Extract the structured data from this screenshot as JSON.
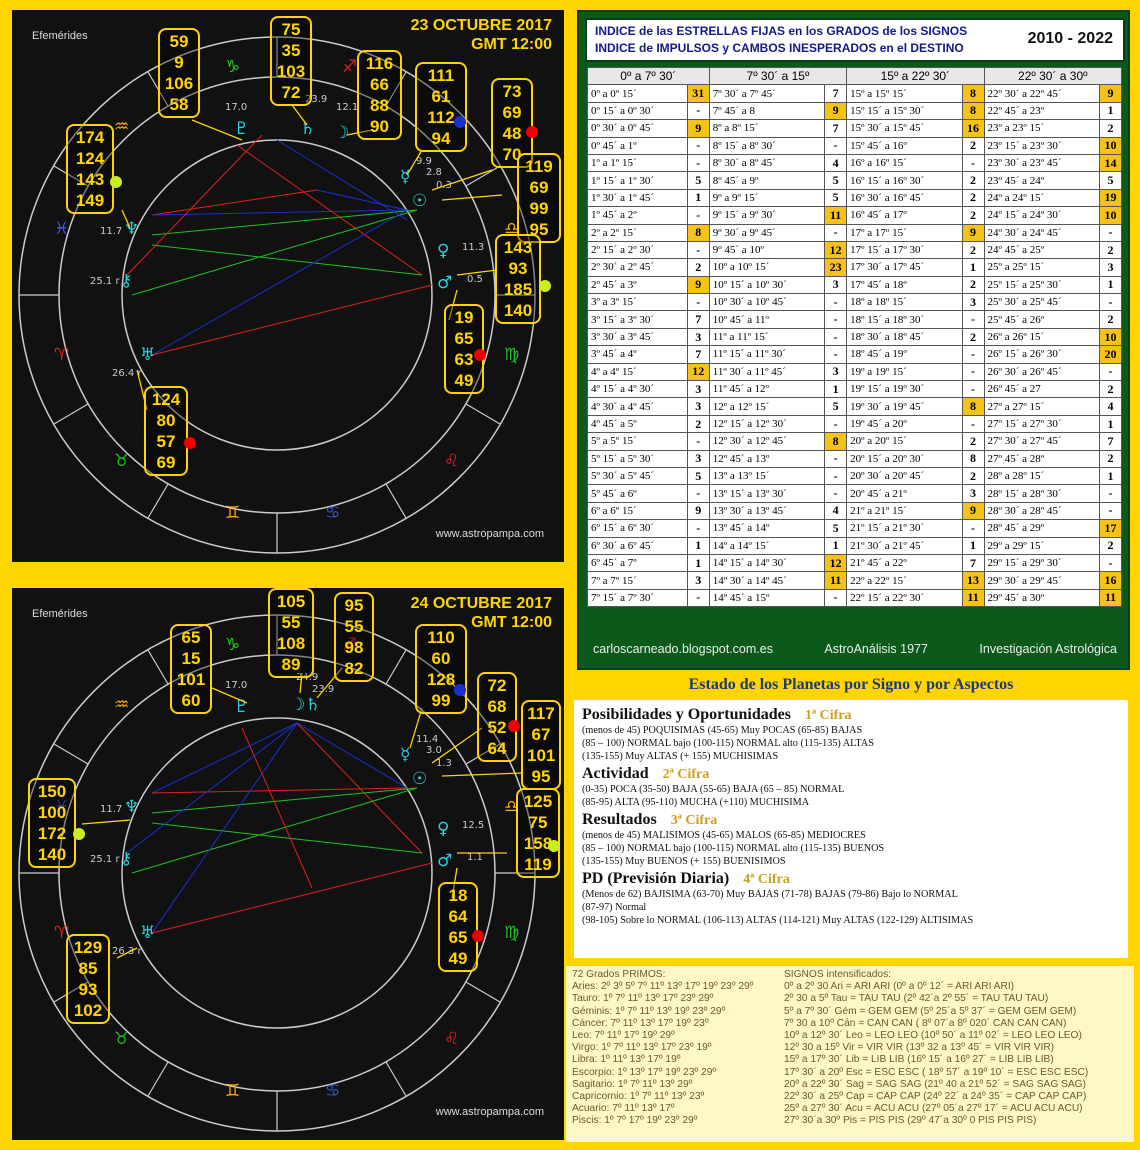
{
  "chart1": {
    "title_date": "23 OCTUBRE 2017",
    "title_time": "GMT 12:00",
    "efemerides": "Efemérides",
    "site": "www.astropampa.com",
    "degrees": [
      "17.0",
      "23.9",
      "12.1",
      "9.9",
      "2.8",
      "0.3",
      "11.3",
      "0.5",
      "11.7",
      "25.1 r",
      "26.4 r"
    ],
    "boxes": [
      {
        "id": "b1",
        "values": [
          "59",
          "9",
          "106",
          "58"
        ]
      },
      {
        "id": "b2",
        "values": [
          "75",
          "35",
          "103",
          "72"
        ]
      },
      {
        "id": "b3",
        "values": [
          "116",
          "66",
          "88",
          "90"
        ]
      },
      {
        "id": "b4",
        "values": [
          "111",
          "61",
          "112",
          "94"
        ]
      },
      {
        "id": "b5",
        "values": [
          "73",
          "69",
          "48",
          "70"
        ]
      },
      {
        "id": "b6",
        "values": [
          "119",
          "69",
          "99",
          "95"
        ]
      },
      {
        "id": "b7",
        "values": [
          "174",
          "124",
          "143",
          "149"
        ]
      },
      {
        "id": "b8",
        "values": [
          "143",
          "93",
          "185",
          "140"
        ]
      },
      {
        "id": "b9",
        "values": [
          "19",
          "65",
          "63",
          "49"
        ]
      },
      {
        "id": "b10",
        "values": [
          "124",
          "80",
          "57",
          "69"
        ]
      }
    ]
  },
  "chart2": {
    "title_date": "24 OCTUBRE 2017",
    "title_time": "GMT 12:00",
    "efemerides": "Efemérides",
    "site": "www.astropampa.com",
    "degrees": [
      "17.0",
      "24.9",
      "23.9",
      "11.4",
      "3.0",
      "1.3",
      "12.5",
      "1.1",
      "11.7",
      "25.1 r",
      "26.3 r"
    ],
    "boxes": [
      {
        "id": "c1",
        "values": [
          "65",
          "15",
          "101",
          "60"
        ]
      },
      {
        "id": "c2",
        "values": [
          "105",
          "55",
          "108",
          "89"
        ]
      },
      {
        "id": "c3",
        "values": [
          "95",
          "55",
          "98",
          "82"
        ]
      },
      {
        "id": "c4",
        "values": [
          "110",
          "60",
          "128",
          "99"
        ]
      },
      {
        "id": "c5",
        "values": [
          "72",
          "68",
          "52",
          "64"
        ]
      },
      {
        "id": "c6",
        "values": [
          "117",
          "67",
          "101",
          "95"
        ]
      },
      {
        "id": "c7",
        "values": [
          "150",
          "100",
          "172",
          "140"
        ]
      },
      {
        "id": "c8",
        "values": [
          "125",
          "75",
          "158",
          "119"
        ]
      },
      {
        "id": "c9",
        "values": [
          "18",
          "64",
          "65",
          "49"
        ]
      },
      {
        "id": "c10",
        "values": [
          "129",
          "85",
          "93",
          "102"
        ]
      }
    ]
  },
  "table": {
    "header_line1": "INDICE de las ESTRELLAS FIJAS en los GRADOS de los SIGNOS",
    "header_line2": "INDICE de IMPULSOS y CAMBOS INESPERADOS en el DESTINO",
    "years": "2010 - 2022",
    "columns": [
      "0º a 7º 30´",
      "7º 30´ a 15º",
      "15º a 22º 30´",
      "22º 30´ a 30º"
    ],
    "highlight_color": "#f5c21a",
    "rows": [
      [
        "0º a 0º 15´",
        "31",
        true,
        "7º 30´ a 7º 45´",
        "7",
        false,
        "15º a 15º 15´",
        "8",
        true,
        "22º 30´ a 22º 45´",
        "9",
        true
      ],
      [
        "0º 15´ a 0º 30´",
        "-",
        false,
        "7º 45´ a 8",
        "9",
        true,
        "15º 15´ a 15º 30´",
        "8",
        true,
        "22º 45´ a 23º",
        "1",
        false
      ],
      [
        "0º 30´ a 0º 45´",
        "9",
        true,
        "8º a 8º 15´",
        "7",
        false,
        "15º 30´ a 15º 45´",
        "16",
        true,
        "23º a 23º 15´",
        "2",
        false
      ],
      [
        "0º 45´ a 1º",
        "-",
        false,
        "8º 15´ a 8º 30´",
        "-",
        false,
        "15º 45´ a 16º",
        "2",
        false,
        "23º 15´ a 23º 30´",
        "10",
        true
      ],
      [
        "1º a 1º 15´",
        "-",
        false,
        "8º 30´ a 8º 45´",
        "4",
        false,
        "16º a 16º 15´",
        "-",
        false,
        "23º 30´ a 23º 45´",
        "14",
        true
      ],
      [
        "1º 15´ a 1º 30´",
        "5",
        false,
        "8º 45´ a 9º",
        "5",
        false,
        "16º 15´ a 16º 30´",
        "2",
        false,
        "23º 45´ a 24º",
        "5",
        false
      ],
      [
        "1º 30´ a 1º 45´",
        "1",
        false,
        "9º a 9º 15´",
        "5",
        false,
        "16º 30´ a 16º 45´",
        "2",
        false,
        "24º a 24º 15´",
        "19",
        true
      ],
      [
        "1º 45´ a 2º",
        "-",
        false,
        "9º 15´ a 9º 30´",
        "11",
        true,
        "16º 45´ a 17º",
        "2",
        false,
        "24º 15´ a 24º 30´",
        "10",
        true
      ],
      [
        "2º a 2º 15´",
        "8",
        true,
        "9º 30´ a 9º 45´",
        "-",
        false,
        "17º a 17º 15´",
        "9",
        true,
        "24º 30´ a 24º 45´",
        "-",
        false
      ],
      [
        "2º 15´ a 2º 30´",
        "-",
        false,
        "9º 45´ a 10º",
        "12",
        true,
        "17º 15´ a 17º 30´",
        "2",
        false,
        "24º 45´ a 25º",
        "2",
        false
      ],
      [
        "2º 30´ a 2º 45´",
        "2",
        false,
        "10º a 10º 15´",
        "23",
        true,
        "17º 30´ a 17º 45´",
        "1",
        false,
        "25º a 25º 15´",
        "3",
        false
      ],
      [
        "2º 45´ a 3º",
        "9",
        true,
        "10º 15´ a 10º 30´",
        "3",
        false,
        "17º 45´ a 18º",
        "2",
        false,
        "25º 15´ a 25º 30´",
        "1",
        false
      ],
      [
        "3º a 3º 15´",
        "-",
        false,
        "10º 30´ a 10º 45´",
        "-",
        false,
        "18º a 18º 15´",
        "3",
        false,
        "25º 30´ a 25º 45´",
        "-",
        false
      ],
      [
        "3º 15´ a 3º 30´",
        "7",
        false,
        "10º 45´ a 11º",
        "-",
        false,
        "18º 15´ a 18º 30´",
        "-",
        false,
        "25º 45´ a 26º",
        "2",
        false
      ],
      [
        "3º 30´ a 3º 45´",
        "3",
        false,
        "11º a 11º 15´",
        "-",
        false,
        "18º 30´ a 18º 45´",
        "2",
        false,
        "26º a 26º 15´",
        "10",
        true
      ],
      [
        "3º 45´ a 4º",
        "7",
        false,
        "11º 15´ a 11º 30´",
        "-",
        false,
        "18º 45´ a 19º",
        "-",
        false,
        "26º 15´ a 26º 30´",
        "20",
        true
      ],
      [
        "4º a 4º 15´",
        "12",
        true,
        "11º 30´ a 11º 45´",
        "3",
        false,
        "19º a 19º 15´",
        "-",
        false,
        "26º 30´ a 26º 45´",
        "-",
        false
      ],
      [
        "4º 15´ a 4º 30´",
        "3",
        false,
        "11º 45´ a 12º",
        "1",
        false,
        "19º 15´ a 19º 30´",
        "-",
        false,
        "26º 45´ a 27",
        "2",
        false
      ],
      [
        "4º 30´ a 4º 45´",
        "3",
        false,
        "12º a 12º 15´",
        "5",
        false,
        "19º 30´ a 19º 45´",
        "8",
        true,
        "27º a 27º 15´",
        "4",
        false
      ],
      [
        "4º 45´ a 5º",
        "2",
        false,
        "12º 15´ a 12º 30´",
        "-",
        false,
        "19º 45´ a 20º",
        "-",
        false,
        "27º 15´ a 27º 30´",
        "1",
        false
      ],
      [
        "5º a 5º 15´",
        "-",
        false,
        "12º 30´ a 12º 45´",
        "8",
        true,
        "20º a 20º 15´",
        "2",
        false,
        "27º 30´ a 27º 45´",
        "7",
        false
      ],
      [
        "5º 15´ a 5º 30´",
        "3",
        false,
        "12º 45´ a 13º",
        "-",
        false,
        "20º 15´ a 20º 30´",
        "8",
        false,
        "27º 45´ a 28º",
        "2",
        false
      ],
      [
        "5º 30´ a 5º 45´",
        "5",
        false,
        "13º a 13º 15´",
        "-",
        false,
        "20º 30´ a 20º 45´",
        "2",
        false,
        "28º a 28º 15´",
        "1",
        false
      ],
      [
        "5º 45´ a 6º",
        "-",
        false,
        "13º 15´ a 13º 30´",
        "-",
        false,
        "20º 45´ a 21º",
        "3",
        false,
        "28º 15´ a 28º 30´",
        "-",
        false
      ],
      [
        "6º a 6º 15´",
        "9",
        false,
        "13º 30´ a 13º 45´",
        "4",
        false,
        "21º a 21º 15´",
        "9",
        true,
        "28º 30´ a 28º 45´",
        "-",
        false
      ],
      [
        "6º 15´ a 6º 30´",
        "-",
        false,
        "13º 45´ a 14º",
        "5",
        false,
        "21º 15´ a 21º 30´",
        "-",
        false,
        "28º 45´ a 29º",
        "17",
        true
      ],
      [
        "6º 30´ a 6º 45´",
        "1",
        false,
        "14º a 14º 15´",
        "1",
        false,
        "21º 30´ a 21º 45´",
        "1",
        false,
        "29º a 29º 15´",
        "2",
        false
      ],
      [
        "6º 45´ a 7º",
        "1",
        false,
        "14º 15´ a 14º 30´",
        "12",
        true,
        "21º 45´ a 22º",
        "7",
        false,
        "29º 15´ a 29º 30´",
        "-",
        false
      ],
      [
        "7º a 7º 15´",
        "3",
        false,
        "14º 30´ a 14º 45´",
        "11",
        true,
        "22º a 22º 15´",
        "13",
        true,
        "29º 30´ a 29º 45´",
        "16",
        true
      ],
      [
        "7º 15´ a 7º 30´",
        "-",
        false,
        "14º 45´ a 15º",
        "-",
        false,
        "22º 15´ a 22º 30´",
        "11",
        true,
        "29º 45´ a 30º",
        "11",
        true
      ]
    ],
    "footer": [
      "carloscarneado.blogspot.com.es",
      "AstroAnálisis 1977",
      "Investigación Astrológica"
    ]
  },
  "estado": {
    "title": "Estado de los Planetas por Signo y por Aspectos",
    "sections": [
      {
        "heading": "Posibilidades y Oportunidades",
        "cifra": "1ª Cifra",
        "lines": [
          "(menos de 45) POQUISIMAS (45-65) Muy POCAS (65-85) BAJAS",
          "(85 – 100) NORMAL bajo (100-115) NORMAL alto (115-135) ALTAS",
          "(135-155) Muy ALTAS (+ 155) MUCHISIMAS"
        ]
      },
      {
        "heading": "Actividad",
        "cifra": "2ª Cifra",
        "lines": [
          "(0-35) POCA (35-50) BAJA (55-65) BAJA (65 – 85) NORMAL",
          "(85-95) ALTA (95-110) MUCHA (+110) MUCHISIMA"
        ]
      },
      {
        "heading": "Resultados",
        "cifra": "3ª Cifra",
        "lines": [
          "(menos de 45) MALISIMOS (45-65) MALOS (65-85) MEDIOCRES",
          "(85 – 100) NORMAL bajo (100-115) NORMAL alto (115-135) BUENOS",
          "(135-155) Muy BUENOS (+ 155) BUENISIMOS"
        ]
      },
      {
        "heading": "PD (Previsión Diaria)",
        "cifra": "4ª Cifra",
        "lines": [
          "(Menos de 62) BAJISIMA (63-70) Muy BAJAS (71-78) BAJAS (79-86) Bajo lo NORMAL",
          "(87-97) Normal",
          "(98-105) Sobre lo NORMAL (106-113) ALTAS (114-121) Muy ALTAS (122-129) ALTISIMAS"
        ]
      }
    ]
  },
  "grados": {
    "title": "72 Grados PRIMOS:",
    "lines": [
      "Aries: 2º 3º 5º 7º 11º 13º 17º 19º 23º 29º",
      "Tauro: 1º 7º 11º 13º 17º 23º 29º",
      "Géminis: 1º 7º 11º 13º 19º 23º 29º",
      "Cáncer: 7º 11º 13º 17º 19º 23º",
      "Leo: 7º 11º 17º 19º 29º",
      "Virgo: 1º 7º 11º 13º 17º 23º 19º",
      "Libra: 1º 11º 13º 17º 19º",
      "Escorpio: 1º 13º 17º 19º 23º 29º",
      "Sagitario: 1º 7º 11º 13º 29º",
      "Capricornio: 1º 7º 11º 13º 23º",
      "Acuario: 7º 11º 13º 17º",
      "Piscis: 1º 7º 17º 19º 23º 29º"
    ]
  },
  "signos": {
    "title": "SIGNOS intensificados:",
    "lines": [
      "0º a 2º 30 Ari = ARI ARI (0º a 0º 12´ = ARI ARI ARI)",
      "2º 30 a 5º Tau = TAU TAU (2º 42´a 2º 55´ = TAU TAU TAU)",
      "5º a 7º 30´ Gém = GEM GEM (5º 25´a 5º 37´ = GEM GEM GEM)",
      "7º 30 a 10º Cán = CAN CAN ( 8º 07´a 8º 020´ CAN CAN CAN)",
      "10º a 12º 30´ Leo = LEO LEO (10º 50´ a 11º 02´ = LEO LEO LEO)",
      "12º 30 a 15º Vir = VIR VIR (13º 32 a 13º 45´ = VIR VIR VIR)",
      "15º a 17º 30´ Lib = LIB LIB (16º 15´ a 16º 27´ = LIB LIB LIB)",
      "17º 30´ a 20º Esc = ESC ESC ( 18º 57´ a 19º 10´ = ESC ESC ESC)",
      "20º a 22º 30´ Sag = SAG SAG (21º 40 a 21º 52´ = SAG SAG SAG)",
      "22º 30´ a 25º Cap = CAP CAP (24º 22´ a 24º 35´ = CAP CAP CAP)",
      "25º a 27º 30´ Acu = ACU ACU (27º 05´a 27º 17´ = ACU ACU ACU)",
      "27º 30´a 30º Pis = PIS PIS (29º 47´a 30º 0 PIS PIS PIS)"
    ]
  }
}
